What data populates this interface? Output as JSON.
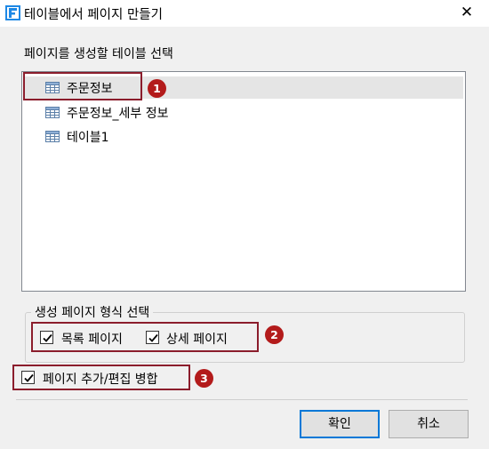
{
  "window": {
    "title": "테이블에서 페이지 만들기",
    "app_icon": "f-app-icon",
    "close_symbol": "✕"
  },
  "table_section": {
    "label": "페이지를 생성할 테이블 선택",
    "items": [
      {
        "label": "주문정보",
        "icon": "table-icon",
        "selected": true
      },
      {
        "label": "주문정보_세부 정보",
        "icon": "table-icon",
        "selected": false
      },
      {
        "label": "테이블1",
        "icon": "table-icon",
        "selected": false
      }
    ]
  },
  "format_section": {
    "label": "생성 페이지 형식 선택",
    "options": [
      {
        "label": "목록 페이지",
        "checked": true
      },
      {
        "label": "상세 페이지",
        "checked": true
      }
    ]
  },
  "merge_option": {
    "label": "페이지 추가/편집 병합",
    "checked": true
  },
  "callouts": [
    "1",
    "2",
    "3"
  ],
  "buttons": {
    "ok": "확인",
    "cancel": "취소"
  },
  "colors": {
    "callout": "#8b1d2c",
    "badge": "#b31b1b",
    "focus": "#0078d7"
  }
}
